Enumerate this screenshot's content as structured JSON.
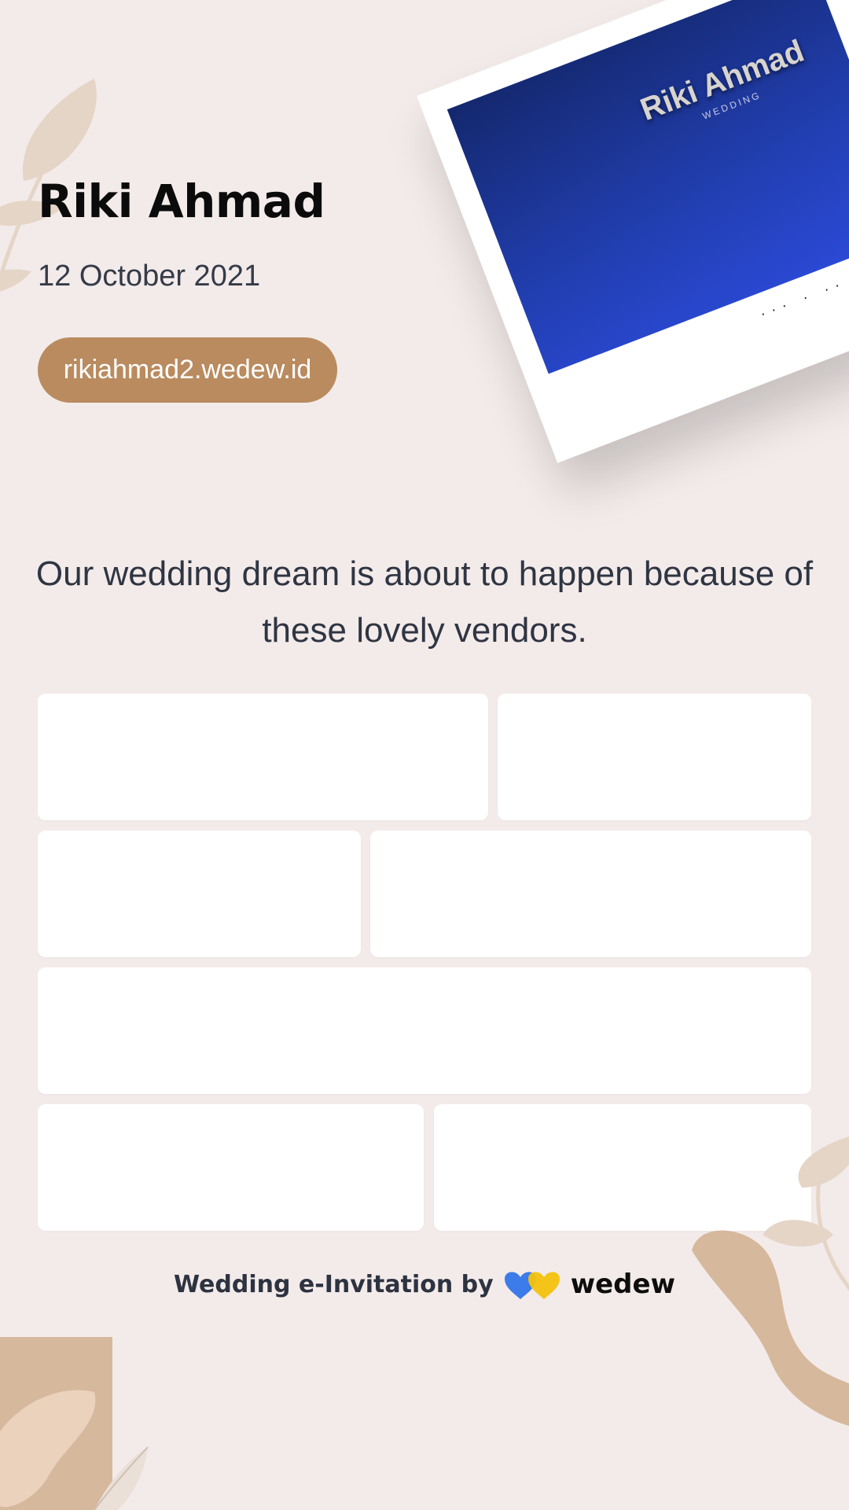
{
  "header": {
    "couple_name": "Riki Ahmad",
    "date": "12 October 2021",
    "url": "rikiahmad2.wedew.id"
  },
  "photo": {
    "title": "Riki Ahmad",
    "subtitle": "WEDDING",
    "dots": "··· · ·· ·"
  },
  "tagline": "Our wedding dream is about to happen because of these lovely vendors.",
  "vendors": [
    {
      "label": ""
    },
    {
      "label": ""
    },
    {
      "label": ""
    },
    {
      "label": ""
    },
    {
      "label": ""
    },
    {
      "label": ""
    },
    {
      "label": ""
    }
  ],
  "footer": {
    "text": "Wedding e-Invitation by",
    "brand": "wedew",
    "brand_icon": "wedew-logo-icon"
  },
  "colors": {
    "background": "#f3ebea",
    "pill": "#b98b5f",
    "photo_top": "#14286e",
    "photo_bottom": "#2b4ad8",
    "leaf": "#d6b89c",
    "heart_blue": "#3b7bea",
    "heart_yellow": "#f4c20d"
  }
}
